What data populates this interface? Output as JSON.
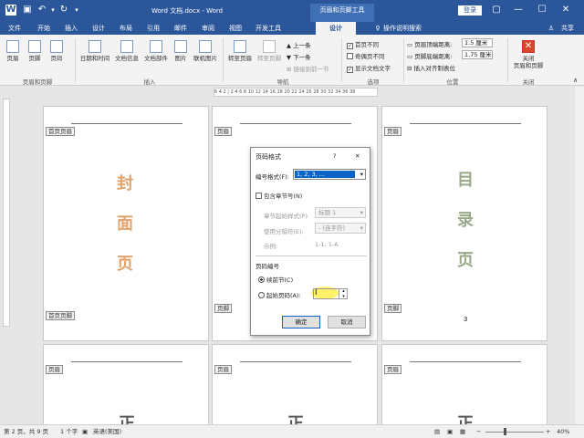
{
  "window": {
    "title": "Word 文档.docx - Word",
    "context_tab": "页眉和页脚工具",
    "login": "登录"
  },
  "tabs": [
    "文件",
    "开始",
    "插入",
    "设计",
    "布局",
    "引用",
    "邮件",
    "审阅",
    "视图",
    "开发工具",
    "设计"
  ],
  "tell_me": "操作说明搜索",
  "share": "共享",
  "ribbon": {
    "group1": {
      "buttons": [
        "页眉",
        "页脚",
        "页码"
      ],
      "label": "页眉和页脚"
    },
    "group2": {
      "buttons": [
        "日期和时间",
        "文档信息",
        "文档部件",
        "图片",
        "联机图片"
      ],
      "label": "插入"
    },
    "group3": {
      "buttons": [
        "转至页眉",
        "转至页脚"
      ],
      "small": [
        "上一条",
        "下一条",
        "链接到前一节"
      ],
      "label": "导航"
    },
    "group4": {
      "checks": [
        {
          "label": "首页不同",
          "checked": true
        },
        {
          "label": "奇偶页不同",
          "checked": false
        },
        {
          "label": "显示文档文字",
          "checked": true
        }
      ],
      "label": "选项"
    },
    "group5": {
      "header_dist_label": "页眉顶端距离:",
      "header_dist": "1.5 厘米",
      "footer_dist_label": "页脚底端距离:",
      "footer_dist": "1.75 厘米",
      "align_tab": "插入对齐制表位",
      "label": "位置"
    },
    "group6": {
      "close": "关闭\n页眉和页脚",
      "label": "关闭"
    }
  },
  "ruler_text": "6 4 2 | 2 4 6 8 10 12 14 16 18 20 22 24 26 28 30 32 34 36 38",
  "pages": {
    "cover": {
      "tag_header": "首页页眉",
      "tag_footer": "首页页脚",
      "chars": [
        "封",
        "面",
        "页"
      ],
      "color": "#e2a36d"
    },
    "middle": {
      "tag_header": "页眉",
      "tag_footer": "页脚"
    },
    "toc": {
      "tag_header": "页眉",
      "tag_footer": "页脚",
      "chars": [
        "目",
        "录",
        "页"
      ],
      "color": "#9aa88a",
      "page_number": "3"
    },
    "row2": {
      "tag": "页眉",
      "char": "正"
    }
  },
  "dialog": {
    "title": "页码格式",
    "help": "?",
    "close": "✕",
    "format_label": "编号格式(F):",
    "format_value": "1, 2, 3, ...",
    "include_chapter": "包含章节号(N)",
    "chapter_style_label": "章节起始样式(P)",
    "chapter_style_value": "标题 1",
    "separator_label": "使用分隔符(E):",
    "separator_value": "- (连字符)",
    "example_label": "示例:",
    "example_value": "1-1, 1-A",
    "numbering_section": "页码编号",
    "continue": "续前节(C)",
    "start_at": "起始页码(A):",
    "ok": "确定",
    "cancel": "取消"
  },
  "status": {
    "page": "第 2 页，共 9 页",
    "words": "1 个字",
    "lang": "英语(美国)",
    "zoom": "40%",
    "zoom_minus": "−",
    "zoom_plus": "+"
  }
}
